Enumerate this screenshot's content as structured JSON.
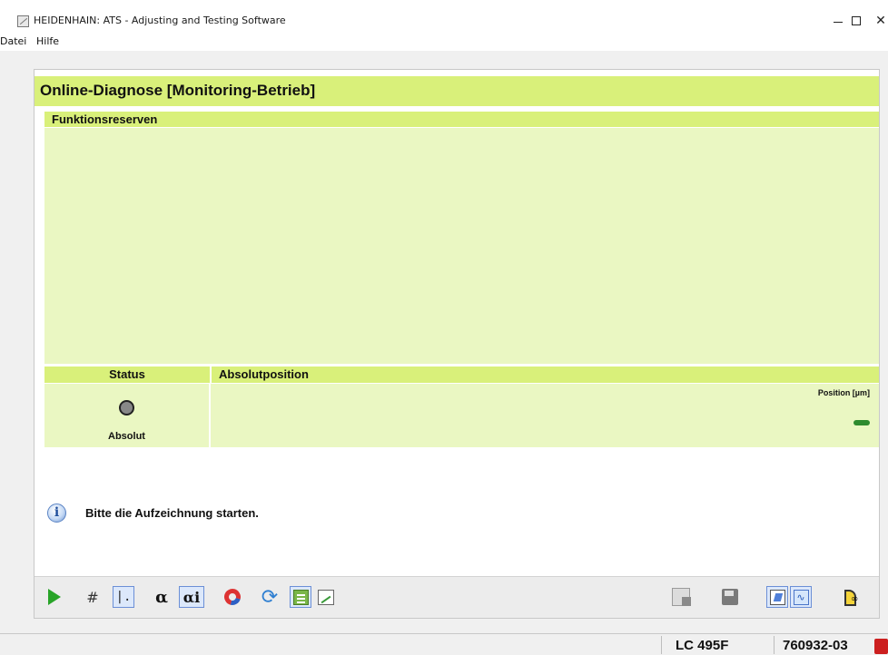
{
  "window": {
    "title": "HEIDENHAIN: ATS - Adjusting and Testing Software",
    "minimize": "–",
    "maximize": "□",
    "close": "✕"
  },
  "menu": {
    "items": [
      {
        "label": "Datei"
      },
      {
        "label": "Hilfe"
      }
    ]
  },
  "page": {
    "title": "Online-Diagnose [Monitoring-Betrieb]"
  },
  "reserves": {
    "header": "Funktionsreserven"
  },
  "status_table": {
    "status_header": "Status",
    "position_header": "Absolutposition",
    "led_label": "Absolut",
    "led_color": "#888888",
    "position_label": "Position [µm]",
    "position_indicator_color": "#2e8b2e"
  },
  "message": {
    "icon": "info-icon",
    "glyph": "i",
    "text": "Bitte die Aufzeichnung starten."
  },
  "toolbar": {
    "icons": {
      "play": "play-icon",
      "grid": "grid-icon",
      "axes": "axes-icon",
      "alpha": "α",
      "alphai": "αi",
      "magnet": "magnet-icon",
      "refresh": "refresh-icon",
      "list": "list-icon",
      "chart": "chart-icon",
      "export": "export-icon",
      "save": "save-icon",
      "note": "note-icon",
      "wave": "wave-icon",
      "exit": "exit-icon"
    },
    "grid_glyph": "#",
    "axes_glyph": "|.",
    "refresh_glyph": "⟳",
    "wave_glyph": "∿"
  },
  "statusbar": {
    "device": "LC 495F",
    "id": "760932-03",
    "alarm_color": "#cc1f1f"
  },
  "colors": {
    "header_green": "#d9f07a",
    "panel_green": "#eaf7c2"
  }
}
